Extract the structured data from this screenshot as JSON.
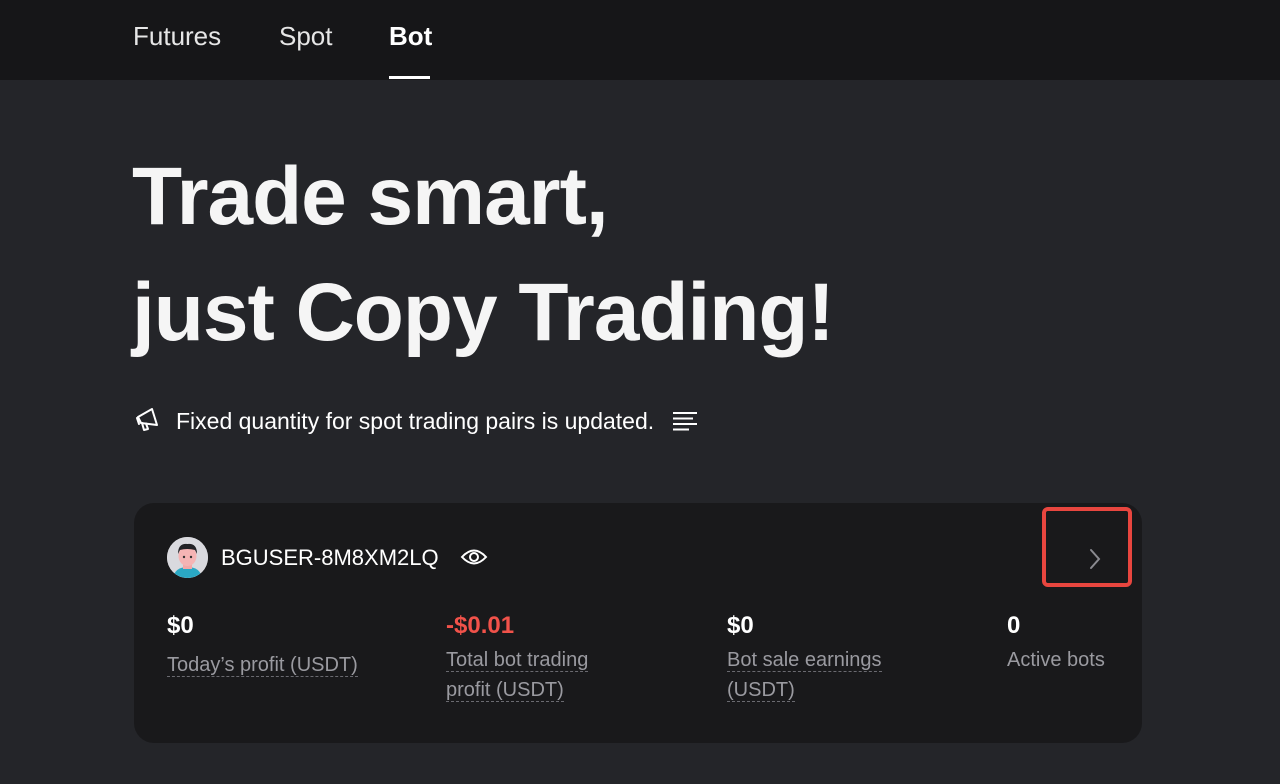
{
  "nav": {
    "tabs": [
      {
        "label": "Futures"
      },
      {
        "label": "Spot"
      },
      {
        "label": "Bot",
        "active": true
      }
    ]
  },
  "hero": {
    "line1": "Trade smart,",
    "line2": "just Copy Trading!"
  },
  "announcement": {
    "text": "Fixed quantity for spot trading pairs is updated.",
    "icon": "megaphone-icon",
    "list_icon": "list-icon"
  },
  "account": {
    "username": "BGUSER-8M8XM2LQ",
    "stats": [
      {
        "value": "$0",
        "label_lines": [
          "Today’s profit (USDT)"
        ]
      },
      {
        "value": "-$0.01",
        "label_lines": [
          "Total bot trading",
          "profit (USDT)"
        ],
        "negative": true
      },
      {
        "value": "$0",
        "label_lines": [
          "Bot sale earnings",
          "(USDT)"
        ]
      },
      {
        "value": "0",
        "label_lines": [
          "Active bots"
        ]
      }
    ]
  },
  "colors": {
    "background": "#242529",
    "topbar": "#161618",
    "card": "#19191b",
    "negative": "#f1524a",
    "highlight": "#e8463f"
  }
}
